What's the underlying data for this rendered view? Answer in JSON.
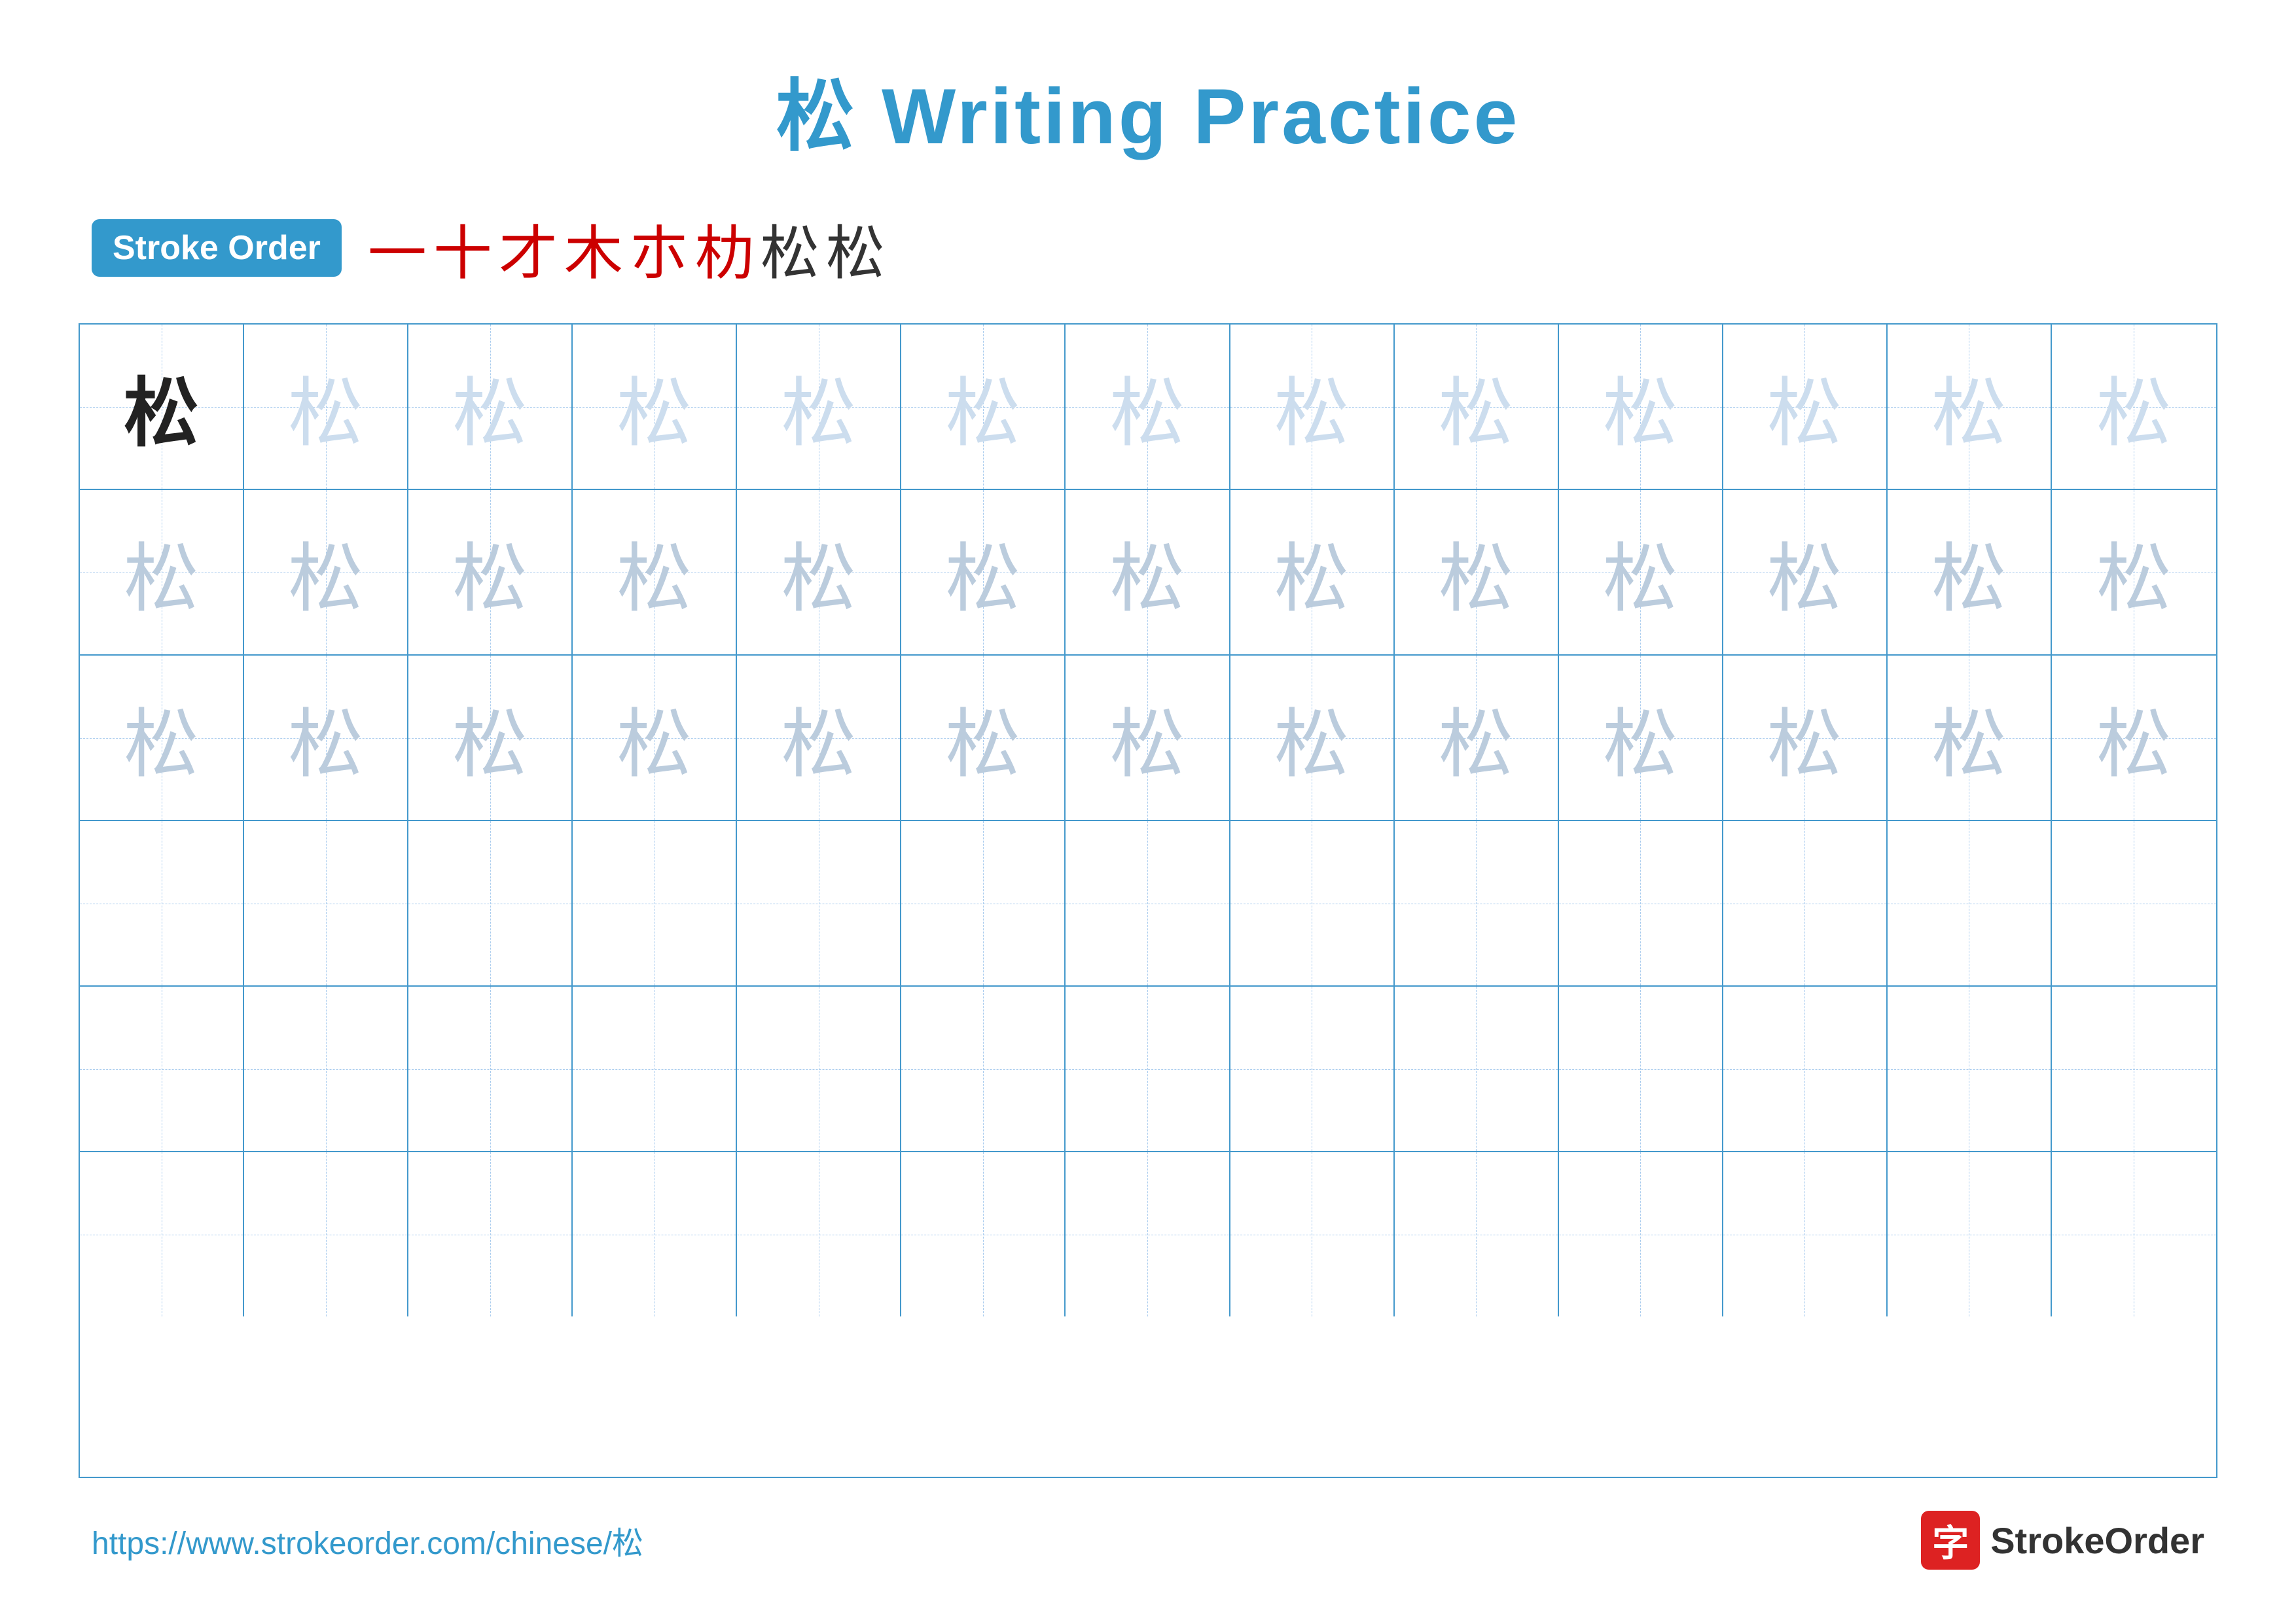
{
  "title": {
    "char": "松",
    "text": "Writing Practice",
    "full": "松 Writing Practice"
  },
  "stroke_order": {
    "badge_label": "Stroke Order",
    "strokes": [
      "一",
      "十",
      "才",
      "木",
      "朩",
      "朸",
      "松",
      "松"
    ]
  },
  "grid": {
    "cols": 13,
    "rows": 6,
    "char": "松",
    "filled_rows": [
      {
        "type": "solid_then_faint",
        "cells": [
          "solid",
          "faint",
          "faint",
          "faint",
          "faint",
          "faint",
          "faint",
          "faint",
          "faint",
          "faint",
          "faint",
          "faint",
          "faint"
        ]
      },
      {
        "type": "medium_faint",
        "cells": [
          "medium",
          "medium",
          "medium",
          "medium",
          "medium",
          "medium",
          "medium",
          "medium",
          "medium",
          "medium",
          "medium",
          "medium",
          "medium"
        ]
      },
      {
        "type": "medium_faint",
        "cells": [
          "medium",
          "medium",
          "medium",
          "medium",
          "medium",
          "medium",
          "medium",
          "medium",
          "medium",
          "medium",
          "medium",
          "medium",
          "medium"
        ]
      },
      {
        "type": "empty"
      },
      {
        "type": "empty"
      },
      {
        "type": "empty"
      }
    ]
  },
  "footer": {
    "url": "https://www.strokeorder.com/chinese/松",
    "logo_char": "字",
    "brand": "StrokeOrder"
  },
  "colors": {
    "blue": "#3399cc",
    "red": "#cc0000",
    "dark": "#222222",
    "faint": "#ccddee",
    "medium": "#bbccdd",
    "logo_red": "#dd2222"
  }
}
